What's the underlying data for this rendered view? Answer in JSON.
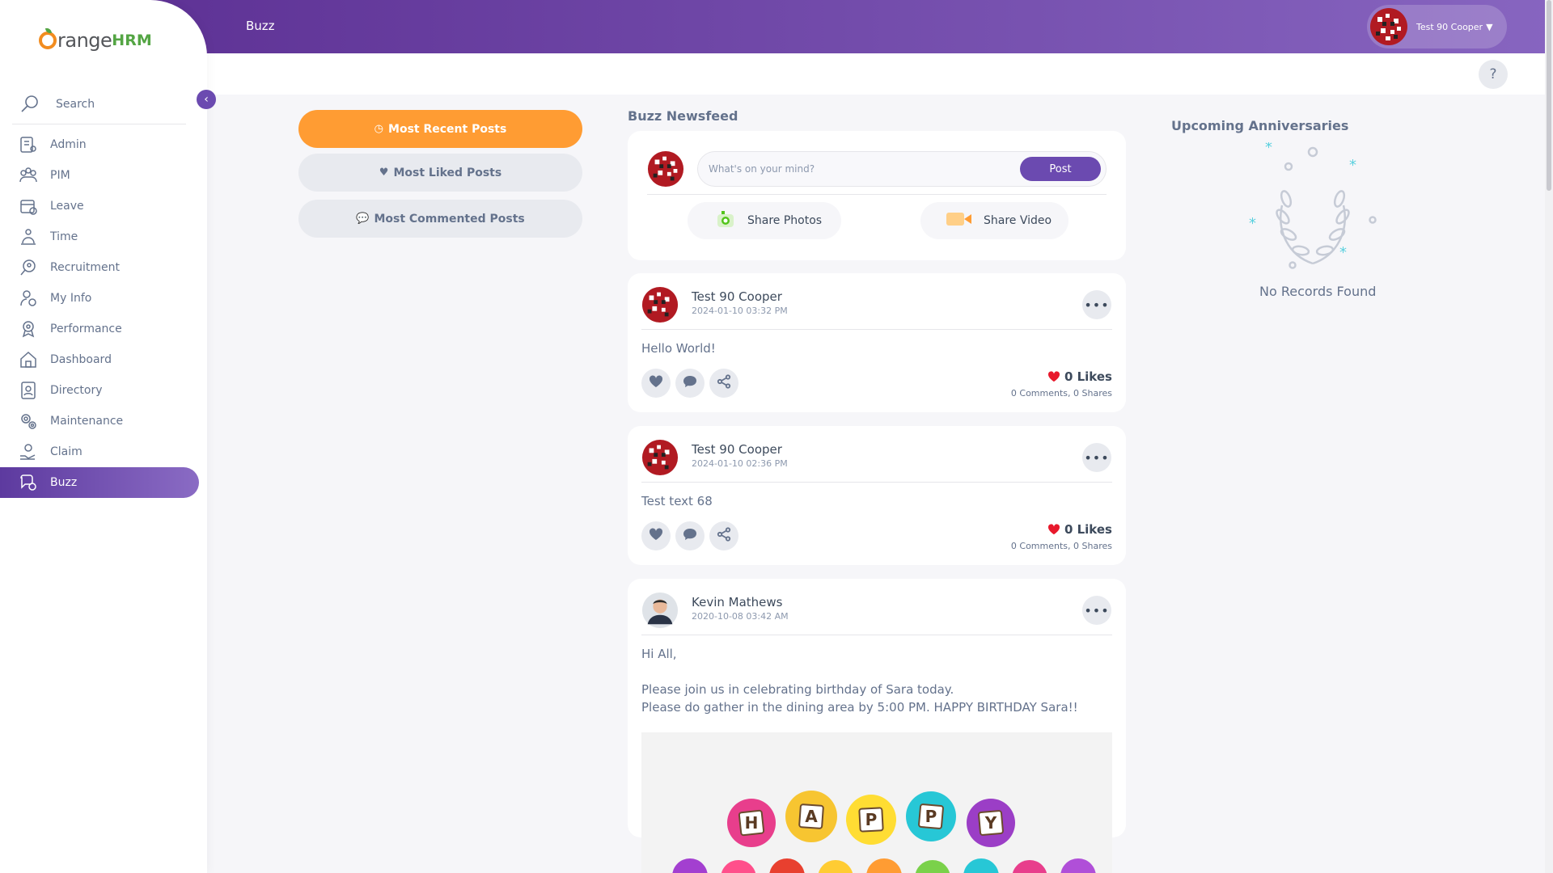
{
  "app": {
    "logo_text": "OrangeHRM",
    "logo_orange": "range",
    "logo_hrm": "HRM"
  },
  "header": {
    "title": "Buzz",
    "user_name": "Test 90 Cooper",
    "help_label": "?"
  },
  "sidebar": {
    "search_label": "Search",
    "items": [
      {
        "label": "Admin",
        "icon": "admin-icon"
      },
      {
        "label": "PIM",
        "icon": "pim-icon"
      },
      {
        "label": "Leave",
        "icon": "leave-icon"
      },
      {
        "label": "Time",
        "icon": "time-icon"
      },
      {
        "label": "Recruitment",
        "icon": "recruitment-icon"
      },
      {
        "label": "My Info",
        "icon": "my-info-icon"
      },
      {
        "label": "Performance",
        "icon": "performance-icon"
      },
      {
        "label": "Dashboard",
        "icon": "dashboard-icon"
      },
      {
        "label": "Directory",
        "icon": "directory-icon"
      },
      {
        "label": "Maintenance",
        "icon": "maintenance-icon"
      },
      {
        "label": "Claim",
        "icon": "claim-icon"
      },
      {
        "label": "Buzz",
        "icon": "buzz-icon",
        "active": true
      }
    ]
  },
  "filters": {
    "most_recent": "Most Recent Posts",
    "most_liked": "Most Liked Posts",
    "most_commented": "Most Commented Posts"
  },
  "feed": {
    "heading": "Buzz Newsfeed",
    "composer": {
      "placeholder": "What's on your mind?",
      "post_label": "Post",
      "share_photos": "Share Photos",
      "share_video": "Share Video"
    },
    "posts": [
      {
        "author": "Test 90 Cooper",
        "time": "2024-01-10 03:32 PM",
        "body": "Hello World!",
        "likes": "0 Likes",
        "comments": "0 Comments",
        "shares": "0 Shares"
      },
      {
        "author": "Test 90 Cooper",
        "time": "2024-01-10 02:36 PM",
        "body": "Test text 68",
        "likes": "0 Likes",
        "comments": "0 Comments",
        "shares": "0 Shares"
      },
      {
        "author": "Kevin Mathews",
        "time": "2020-10-08 03:42 AM",
        "body": "Hi All,\n\nPlease join us in celebrating birthday of Sara today.\nPlease do gather in the dining area by 5:00 PM. HAPPY BIRTHDAY Sara!!",
        "image_letters": [
          "H",
          "A",
          "P",
          "P",
          "Y"
        ]
      }
    ]
  },
  "anniversaries": {
    "title": "Upcoming Anniversaries",
    "empty_text": "No Records Found"
  },
  "colors": {
    "brand_purple": "#6b4ab0",
    "accent_orange": "#ff9c33",
    "heart_red": "#e8192c"
  }
}
